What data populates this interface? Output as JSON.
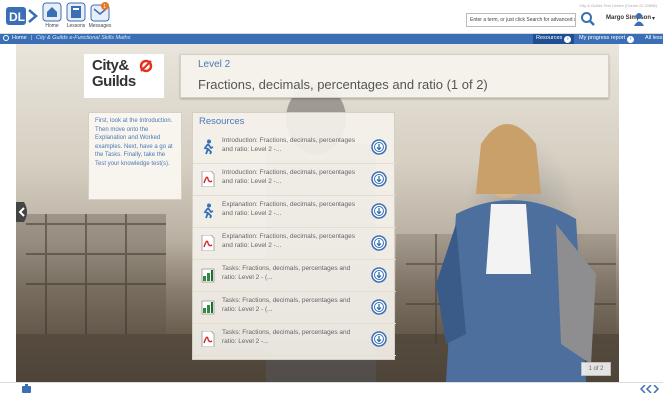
{
  "header": {
    "nav": [
      {
        "label": "Home",
        "icon": "home-icon"
      },
      {
        "label": "Lessons",
        "icon": "lessons-icon"
      },
      {
        "label": "Messages",
        "icon": "messages-icon",
        "badge": "1"
      }
    ],
    "search_placeholder": "Enter a term, or just click Search for advanced s",
    "version_text": "City & Guilds Test Centre (Centre ID 22888)",
    "user_name": "Margo Simpson",
    "caret": "▾"
  },
  "breadcrumb": {
    "home": "Home",
    "course": "City & Guilds e-Functional Skills Maths",
    "resources_tab": "Resources",
    "progress_tab": "My progress report",
    "all_label": "All less"
  },
  "brand": {
    "line1": "City&",
    "line2": "Guilds",
    "accent": "#e3321b",
    "text_color": "#333333"
  },
  "content": {
    "level": "Level 2",
    "title": "Fractions, decimals, percentages and ratio (1 of 2)",
    "instructions": "First, look at the Introduction. Then move onto the Explanation and Worked examples. Next, have a go at the Tasks. Finally, take the Test your knowledge test(s).",
    "resources_heading": "Resources",
    "resources": [
      {
        "label": "Introduction: Fractions, decimals, percentages and ratio: Level 2 -...",
        "icon": "runner-icon"
      },
      {
        "label": "Introduction: Fractions, decimals, percentages and ratio: Level 2 -...",
        "icon": "pdf-icon"
      },
      {
        "label": "Explanation: Fractions, decimals, percentages and ratio: Level 2 -...",
        "icon": "runner-icon"
      },
      {
        "label": "Explanation: Fractions, decimals, percentages and ratio: Level 2 -...",
        "icon": "pdf-icon"
      },
      {
        "label": "Tasks: Fractions, decimals, percentages and ratio: Level 2 - (...",
        "icon": "spreadsheet-icon"
      },
      {
        "label": "Tasks: Fractions, decimals, percentages and ratio: Level 2 - (...",
        "icon": "spreadsheet-icon"
      },
      {
        "label": "Tasks: Fractions, decimals, percentages and ratio: Level 2 -...",
        "icon": "pdf-icon"
      }
    ],
    "page_indicator": "1 of 2"
  },
  "colors": {
    "accent_blue": "#3a6fb5",
    "link_blue": "#4a79b8"
  }
}
